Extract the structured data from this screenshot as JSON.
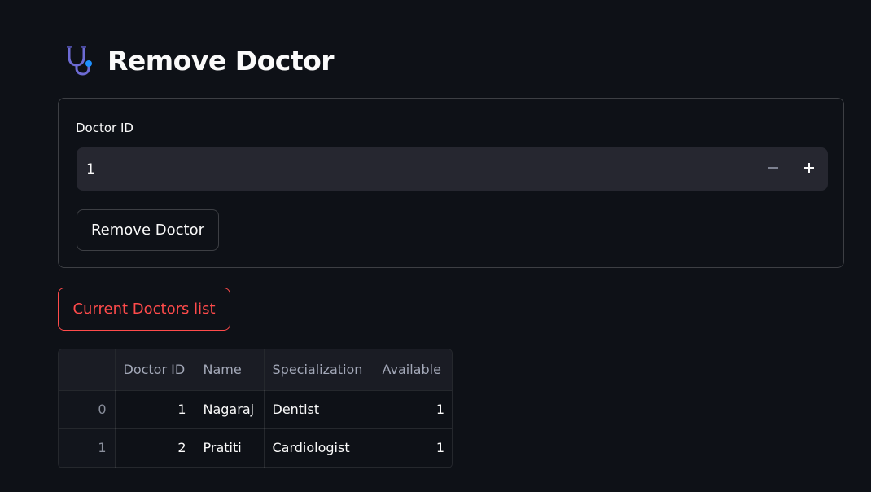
{
  "page": {
    "title": "Remove Doctor",
    "title_icon": "stethoscope-icon"
  },
  "form": {
    "field_label": "Doctor ID",
    "field_value": "1",
    "minus_icon": "minus-icon",
    "plus_icon": "plus-icon",
    "remove_button_label": "Remove Doctor"
  },
  "list_button_label": "Current Doctors list",
  "table": {
    "columns": [
      "",
      "Doctor ID",
      "Name",
      "Specialization",
      "Available"
    ],
    "rows": [
      {
        "index": "0",
        "doctor_id": "1",
        "name": "Nagaraj",
        "specialization": "Dentist",
        "available": "1"
      },
      {
        "index": "1",
        "doctor_id": "2",
        "name": "Pratiti",
        "specialization": "Cardiologist",
        "available": "1"
      }
    ]
  },
  "colors": {
    "background": "#0e1117",
    "accent": "#ff4b4b",
    "input_bg": "#262730",
    "icon_tube": "#6d6bd4",
    "icon_chest": "#1e90ff"
  }
}
